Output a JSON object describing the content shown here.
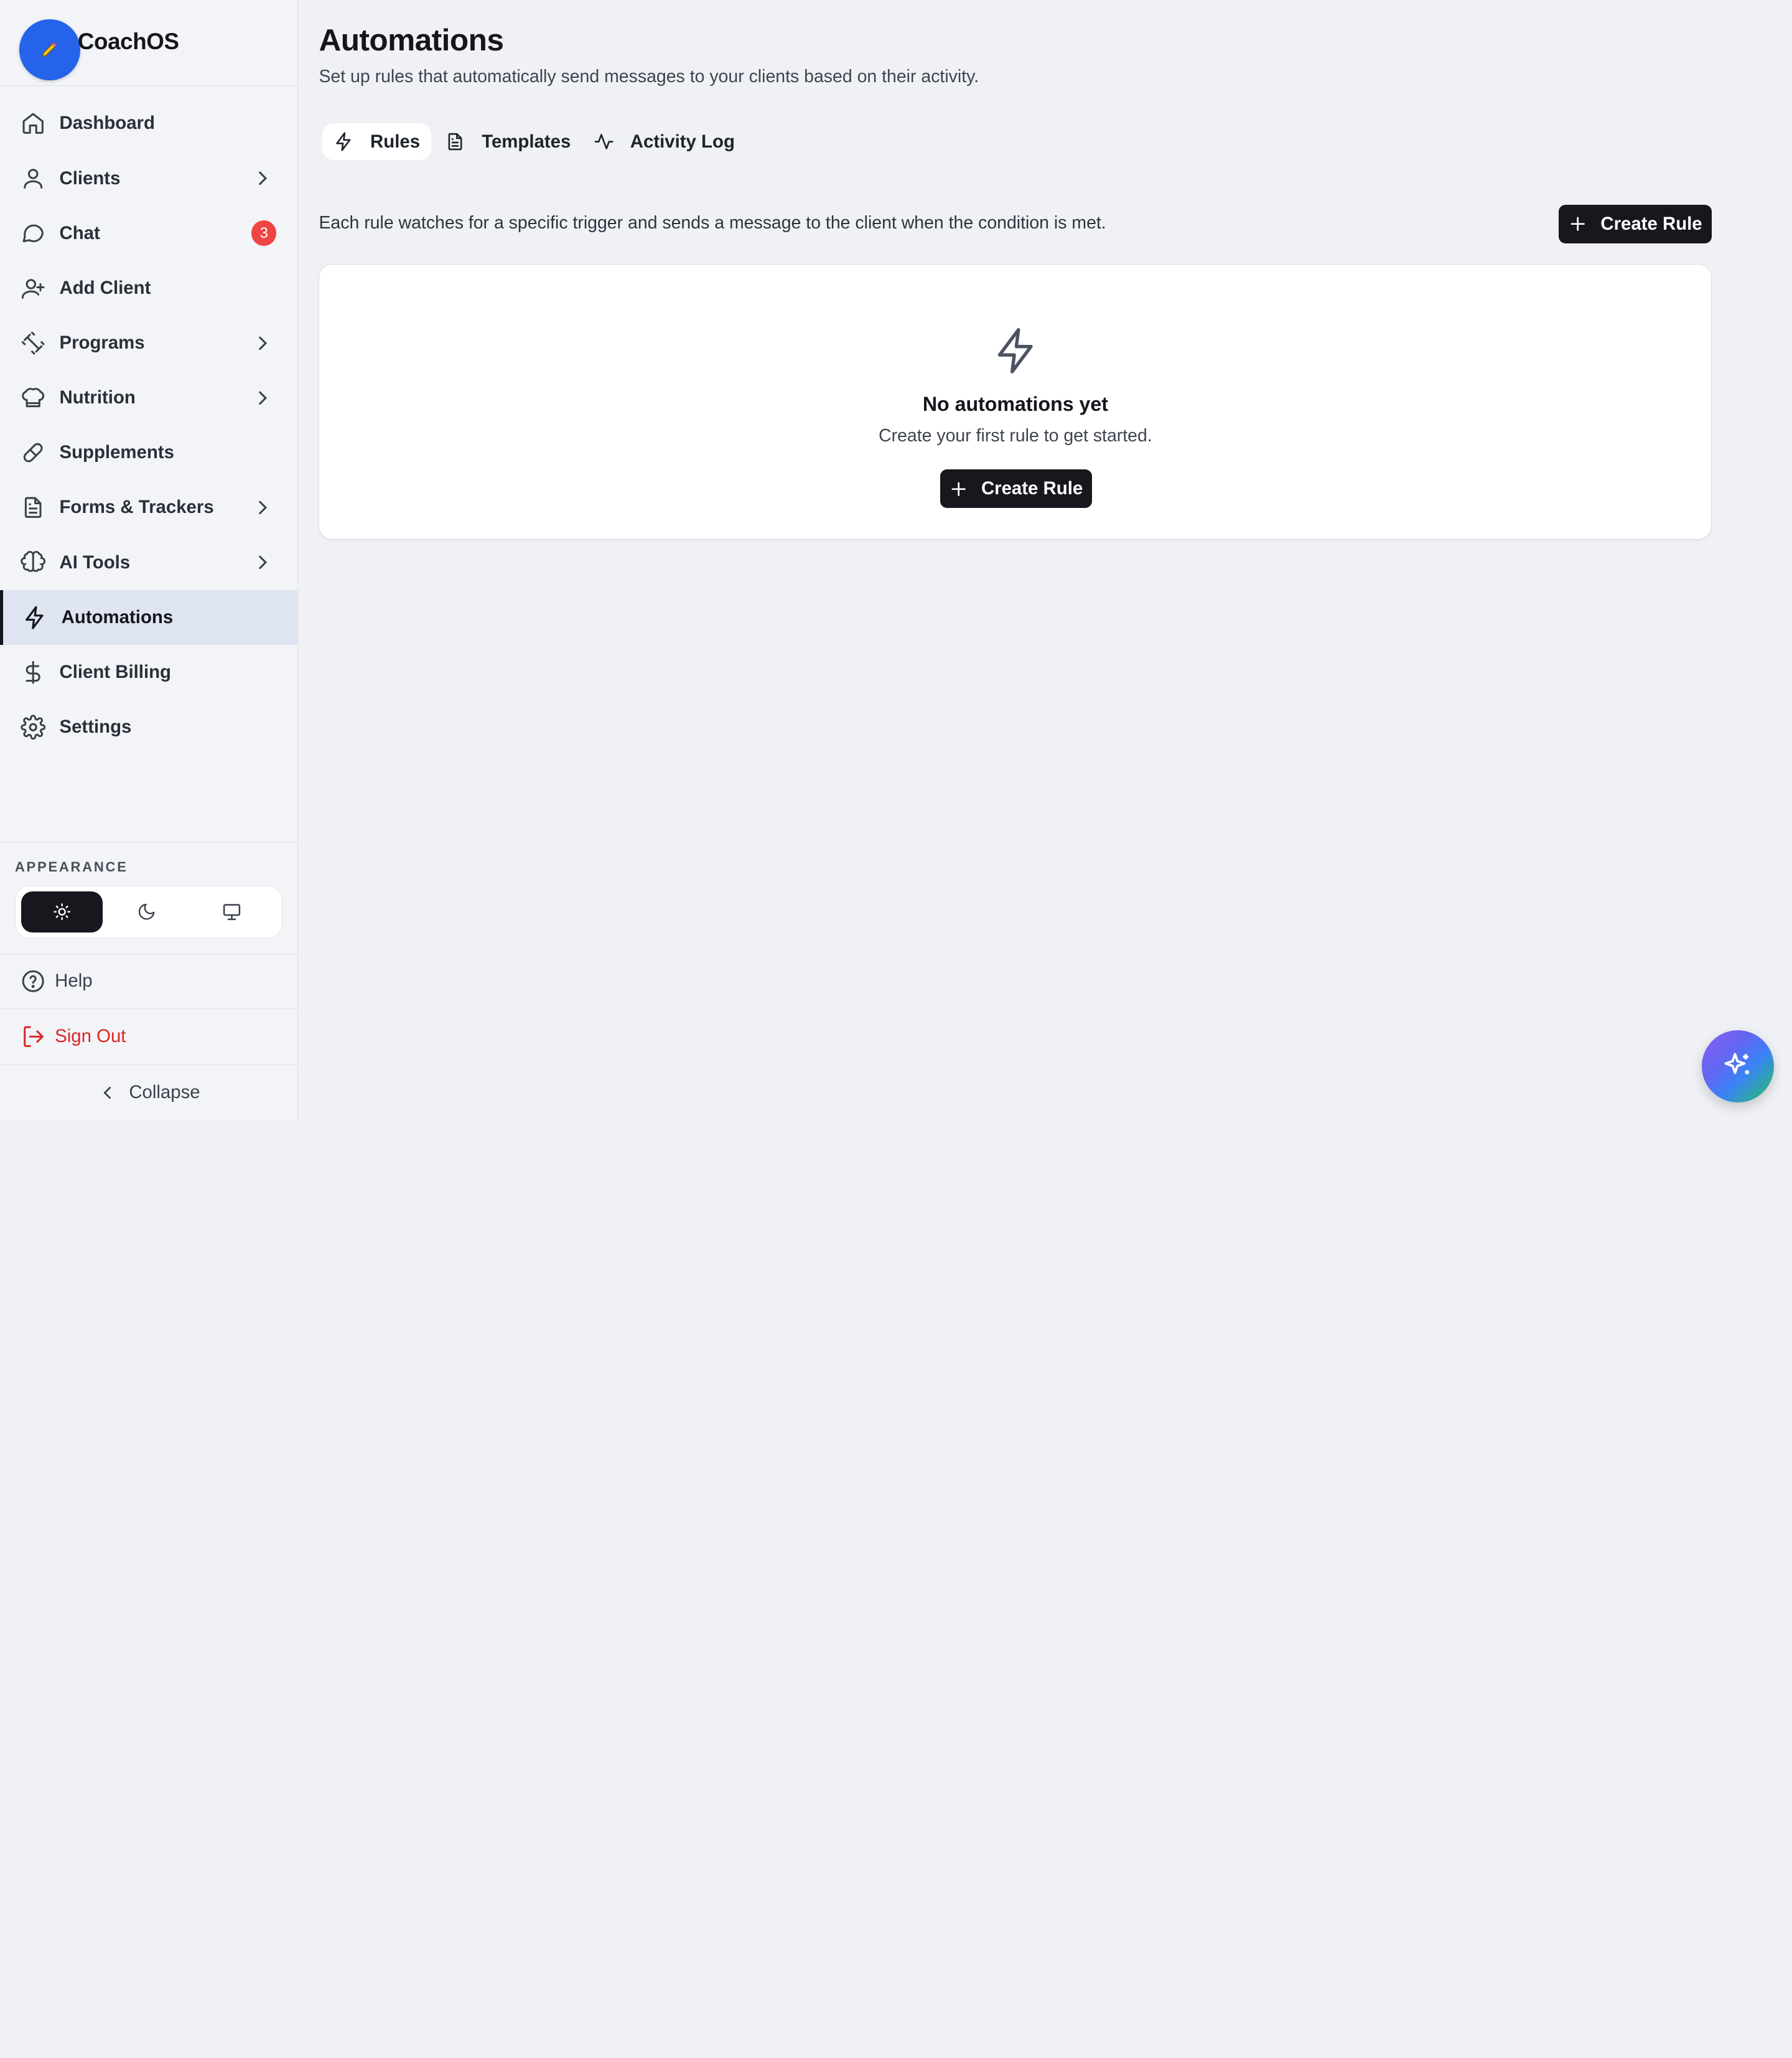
{
  "brand": {
    "name": "CoachOS",
    "logo_icon": "pencil-icon",
    "logo_color": "#2563eb"
  },
  "sidebar": {
    "items": [
      {
        "label": "Dashboard",
        "icon": "home-icon"
      },
      {
        "label": "Clients",
        "icon": "user-icon",
        "has_submenu": true
      },
      {
        "label": "Chat",
        "icon": "chat-icon",
        "badge": "3"
      },
      {
        "label": "Add Client",
        "icon": "user-plus-icon"
      },
      {
        "label": "Programs",
        "icon": "dumbbell-icon",
        "has_submenu": true
      },
      {
        "label": "Nutrition",
        "icon": "chef-hat-icon",
        "has_submenu": true
      },
      {
        "label": "Supplements",
        "icon": "pill-icon"
      },
      {
        "label": "Forms & Trackers",
        "icon": "document-icon",
        "has_submenu": true
      },
      {
        "label": "AI Tools",
        "icon": "brain-icon",
        "has_submenu": true
      },
      {
        "label": "Automations",
        "icon": "zap-icon",
        "active": true
      },
      {
        "label": "Client Billing",
        "icon": "dollar-icon"
      },
      {
        "label": "Settings",
        "icon": "gear-icon"
      }
    ],
    "appearance_label": "APPEARANCE",
    "theme_options": [
      {
        "icon": "sun-icon",
        "selected": true
      },
      {
        "icon": "moon-icon",
        "selected": false
      },
      {
        "icon": "monitor-icon",
        "selected": false
      }
    ],
    "help_label": "Help",
    "signout_label": "Sign Out",
    "collapse_label": "Collapse"
  },
  "main": {
    "title": "Automations",
    "subtitle": "Set up rules that automatically send messages to your clients based on their activity.",
    "tabs": [
      {
        "label": "Rules",
        "icon": "zap-icon",
        "active": true
      },
      {
        "label": "Templates",
        "icon": "document-icon",
        "active": false
      },
      {
        "label": "Activity Log",
        "icon": "activity-icon",
        "active": false
      }
    ],
    "info_text": "Each rule watches for a specific trigger and sends a message to the client when the condition is met.",
    "create_rule_label": "Create Rule",
    "empty_state": {
      "icon": "zap-icon",
      "title": "No automations yet",
      "subtitle": "Create your first rule to get started.",
      "button_label": "Create Rule"
    }
  },
  "fab": {
    "icon": "sparkles-icon"
  },
  "colors": {
    "accent_dark": "#16181d",
    "badge_red": "#ef4444",
    "signout_red": "#dc2626",
    "active_bg": "#dfe4f1"
  }
}
